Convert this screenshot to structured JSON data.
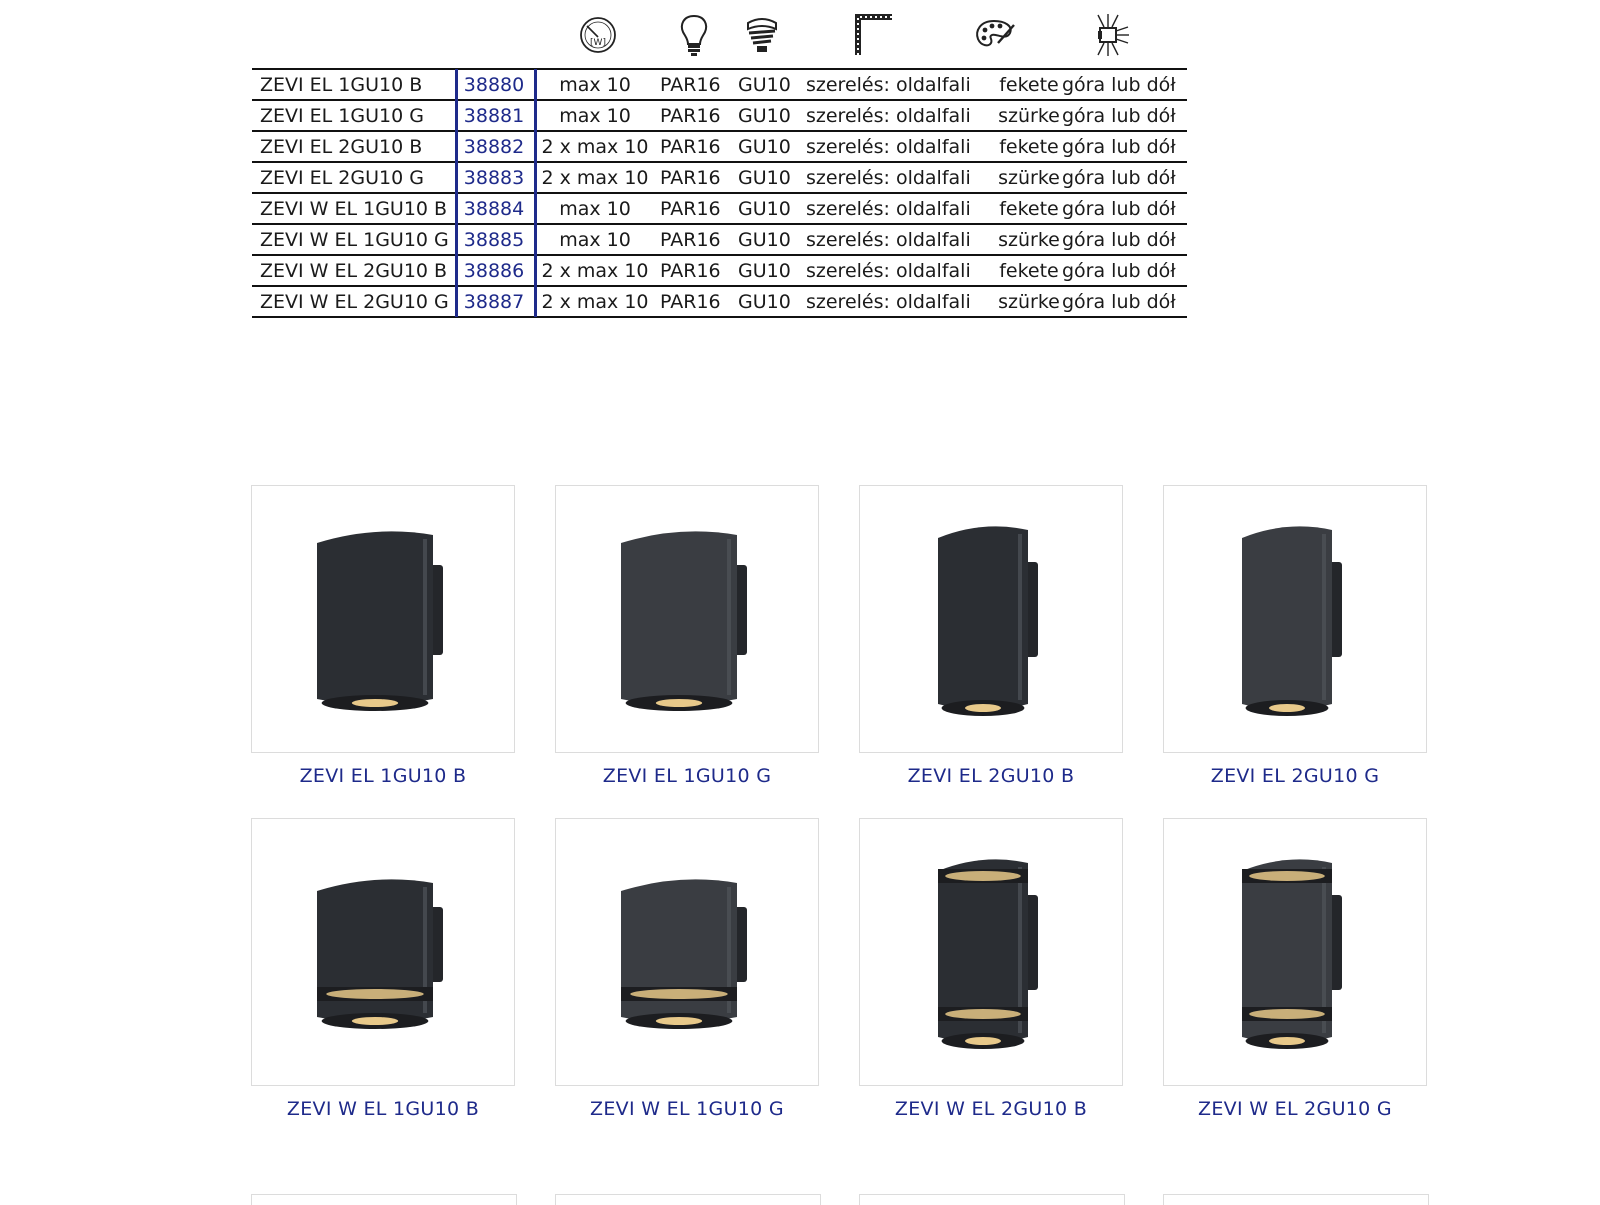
{
  "table": {
    "header_icons": [
      "wattage-dial-icon",
      "bulb-icon",
      "socket-icon",
      "wall-mount-icon",
      "palette-icon",
      "light-direction-icon"
    ],
    "wattage_icon_text": "[W]",
    "rows": [
      {
        "name": "ZEVI EL 1GU10 B",
        "code": "38880",
        "watt": "max 10",
        "bulb": "PAR16",
        "socket": "GU10",
        "mount": "szerelés: oldalfali",
        "color": "fekete",
        "direction": "góra lub dół"
      },
      {
        "name": "ZEVI EL 1GU10 G",
        "code": "38881",
        "watt": "max 10",
        "bulb": "PAR16",
        "socket": "GU10",
        "mount": "szerelés: oldalfali",
        "color": "szürke",
        "direction": "góra lub dół"
      },
      {
        "name": "ZEVI EL 2GU10 B",
        "code": "38882",
        "watt": "2 x max 10",
        "bulb": "PAR16",
        "socket": "GU10",
        "mount": "szerelés: oldalfali",
        "color": "fekete",
        "direction": "góra lub dół"
      },
      {
        "name": "ZEVI EL 2GU10 G",
        "code": "38883",
        "watt": "2 x max 10",
        "bulb": "PAR16",
        "socket": "GU10",
        "mount": "szerelés: oldalfali",
        "color": "szürke",
        "direction": "góra lub dół"
      },
      {
        "name": "ZEVI W EL 1GU10 B",
        "code": "38884",
        "watt": "max 10",
        "bulb": "PAR16",
        "socket": "GU10",
        "mount": "szerelés: oldalfali",
        "color": "fekete",
        "direction": "góra lub dół"
      },
      {
        "name": "ZEVI W EL 1GU10 G",
        "code": "38885",
        "watt": "max 10",
        "bulb": "PAR16",
        "socket": "GU10",
        "mount": "szerelés: oldalfali",
        "color": "szürke",
        "direction": "góra lub dół"
      },
      {
        "name": "ZEVI W EL 2GU10 B",
        "code": "38886",
        "watt": "2 x max 10",
        "bulb": "PAR16",
        "socket": "GU10",
        "mount": "szerelés: oldalfali",
        "color": "fekete",
        "direction": "góra lub dół"
      },
      {
        "name": "ZEVI W EL 2GU10 G",
        "code": "38887",
        "watt": "2 x max 10",
        "bulb": "PAR16",
        "socket": "GU10",
        "mount": "szerelés: oldalfali",
        "color": "szürke",
        "direction": "góra lub dół"
      }
    ]
  },
  "gallery": {
    "products": [
      {
        "caption": "ZEVI EL 1GU10 B",
        "image": "lamp-short-down-black-icon"
      },
      {
        "caption": "ZEVI EL 1GU10 G",
        "image": "lamp-short-down-grey-icon"
      },
      {
        "caption": "ZEVI EL 2GU10 B",
        "image": "lamp-tall-down-black-icon"
      },
      {
        "caption": "ZEVI EL 2GU10 G",
        "image": "lamp-tall-down-grey-icon"
      },
      {
        "caption": "ZEVI W EL 1GU10 B",
        "image": "lamp-window-single-black-icon"
      },
      {
        "caption": "ZEVI W EL 1GU10 G",
        "image": "lamp-window-single-grey-icon"
      },
      {
        "caption": "ZEVI W EL 2GU10 B",
        "image": "lamp-window-double-black-icon"
      },
      {
        "caption": "ZEVI W EL 2GU10 G",
        "image": "lamp-window-double-grey-icon"
      }
    ]
  },
  "colors": {
    "accent_blue": "#1e2a8a",
    "rule": "#111111",
    "card_border": "#dcdcdc",
    "lamp_black": "#2b2e33",
    "lamp_grey": "#3a3d42",
    "lamp_glow": "#e8c98a"
  }
}
